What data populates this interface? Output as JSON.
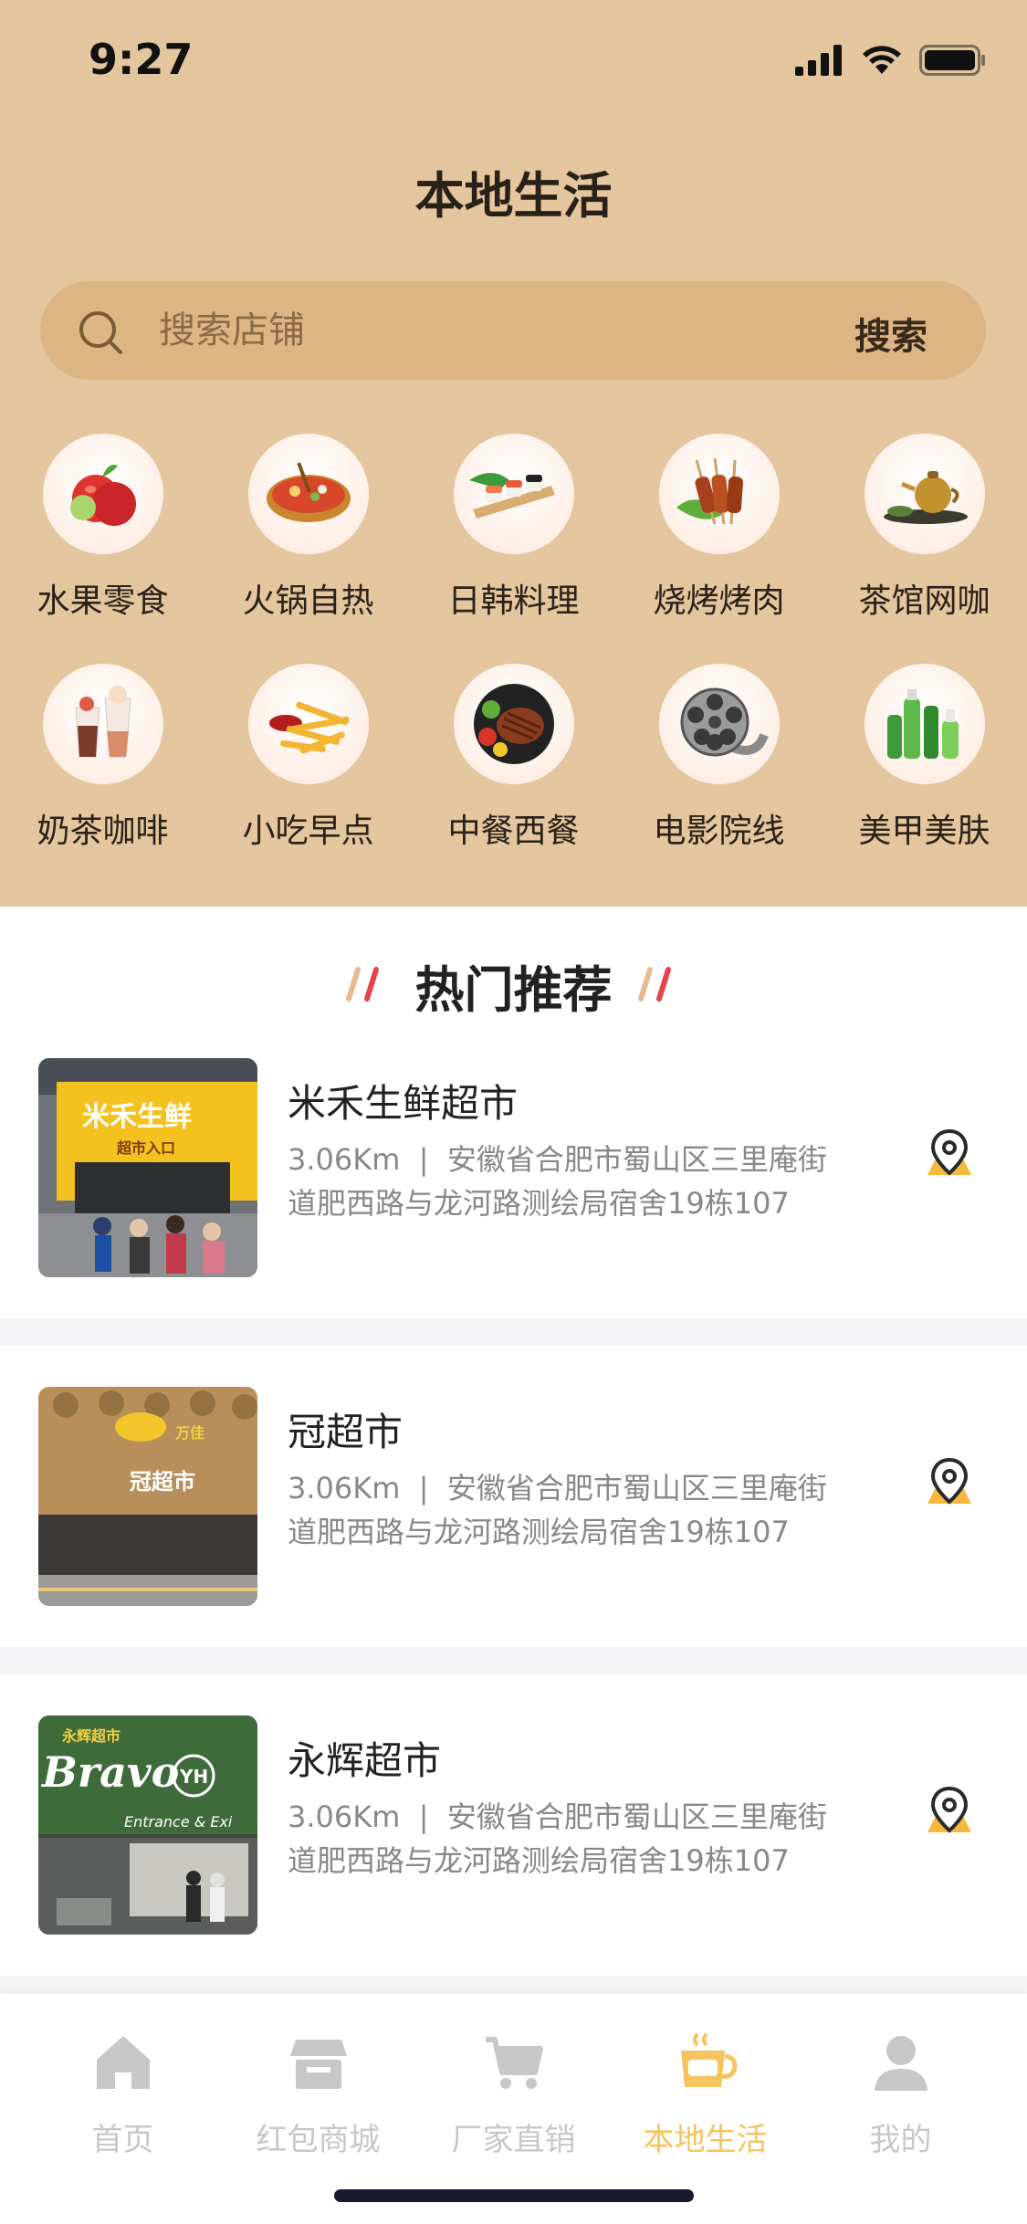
{
  "status": {
    "time": "9:27"
  },
  "header": {
    "title": "本地生活"
  },
  "search": {
    "placeholder": "搜索店铺",
    "button_label": "搜索"
  },
  "categories": [
    {
      "label": "水果零食",
      "icon": "fruit-icon"
    },
    {
      "label": "火锅自热",
      "icon": "hotpot-icon"
    },
    {
      "label": "日韩料理",
      "icon": "sushi-icon"
    },
    {
      "label": "烧烤烤肉",
      "icon": "bbq-icon"
    },
    {
      "label": "茶馆网咖",
      "icon": "tea-icon"
    },
    {
      "label": "奶茶咖啡",
      "icon": "milktea-icon"
    },
    {
      "label": "小吃早点",
      "icon": "fries-icon"
    },
    {
      "label": "中餐西餐",
      "icon": "steak-icon"
    },
    {
      "label": "电影院线",
      "icon": "film-reel-icon"
    },
    {
      "label": "美甲美肤",
      "icon": "cosmetics-icon"
    }
  ],
  "section": {
    "title": "热门推荐"
  },
  "stores": [
    {
      "name": "米禾生鲜超市",
      "distance": "3.06Km",
      "address_line1": "安徽省合肥市蜀山区三里庵街",
      "address_line2": "道肥西路与龙河路测绘局宿舍19栋107"
    },
    {
      "name": "冠超市",
      "distance": "3.06Km",
      "address_line1": "安徽省合肥市蜀山区三里庵街",
      "address_line2": "道肥西路与龙河路测绘局宿舍19栋107"
    },
    {
      "name": "永辉超市",
      "distance": "3.06Km",
      "address_line1": "安徽省合肥市蜀山区三里庵街",
      "address_line2": "道肥西路与龙河路测绘局宿舍19栋107"
    }
  ],
  "store_signs": {
    "store1_sign": "米禾生鲜",
    "store1_sub": "超市入口",
    "store2_sign": "冠超市",
    "store3_sign": "Bravo",
    "store3_badge": "YH",
    "store3_top": "永辉超市",
    "store3_entrance": "Entrance & Exi"
  },
  "tabbar": {
    "tabs": [
      {
        "label": "首页",
        "icon": "home-icon",
        "active": false
      },
      {
        "label": "红包商城",
        "icon": "store-icon",
        "active": false
      },
      {
        "label": "厂家直销",
        "icon": "cart-icon",
        "active": false
      },
      {
        "label": "本地生活",
        "icon": "coffee-cup-icon",
        "active": true
      },
      {
        "label": "我的",
        "icon": "user-icon",
        "active": false
      }
    ]
  },
  "colors": {
    "header_bg": "#E3C59E",
    "search_bg": "#DDB585",
    "accent": "#F5C45E",
    "pin": "#F5B93E"
  }
}
